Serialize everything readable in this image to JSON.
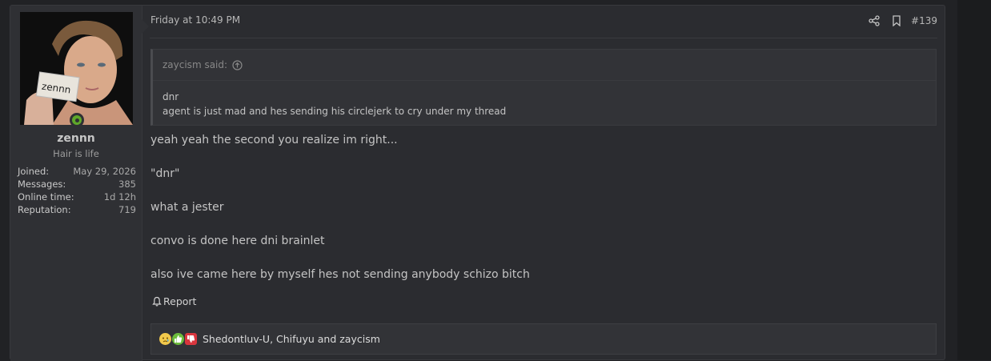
{
  "user": {
    "name": "zennn",
    "title": "Hair is life",
    "avatar_note": "zennn",
    "stats": [
      {
        "label": "Joined:",
        "value": "May 29, 2026"
      },
      {
        "label": "Messages:",
        "value": "385"
      },
      {
        "label": "Online time:",
        "value": "1d 12h"
      },
      {
        "label": "Reputation:",
        "value": "719"
      }
    ]
  },
  "post": {
    "date": "Friday at 10:49 PM",
    "number": "#139"
  },
  "quote": {
    "author": "zaycism said:",
    "lines": [
      "dnr",
      "agent is just mad and hes sending his circlejerk to cry under my thread"
    ]
  },
  "message": [
    "yeah yeah the second you realize im right...",
    "\"dnr\"",
    "what a jester",
    "convo is done here dni brainlet",
    "also ive came here by myself hes not sending anybody schizo bitch"
  ],
  "report_label": "Report",
  "reactions": {
    "users_text": "Shedontluv-U, Chifuyu and zaycism"
  },
  "colors": {
    "online": "#5fa82a",
    "like": "#6cbc3c",
    "dislike": "#d9363e",
    "cry": "#f2c94c"
  }
}
